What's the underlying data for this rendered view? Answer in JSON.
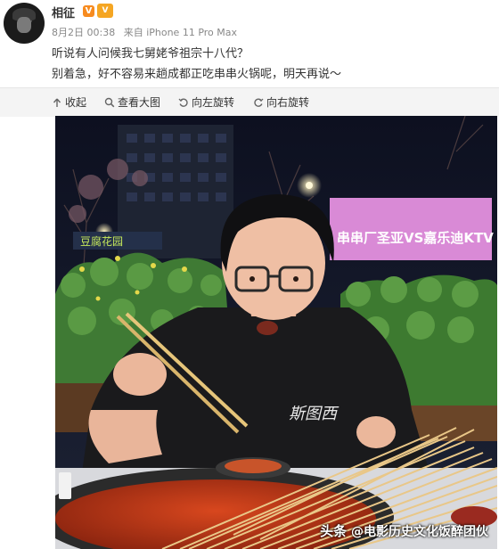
{
  "post": {
    "username": "相征",
    "v_badge": "V",
    "vip_badge": "V",
    "date": "8月2日 00:38",
    "source": "来自 iPhone 11 Pro Max",
    "text_line1": "听说有人问候我七舅姥爷祖宗十八代？",
    "text_line2": "别着急，好不容易来趟成都正吃串串火锅呢，明天再说～"
  },
  "toolbar": {
    "collapse_label": "收起",
    "view_large_label": "查看大图",
    "rotate_left_label": "向左旋转",
    "rotate_right_label": "向右旋转"
  },
  "photo": {
    "sign_left": "豆腐花园",
    "sign_right": "串串厂圣亚VS嘉乐迪KTV",
    "shirt_text": "斯图西",
    "watermark_prefix": "头条",
    "watermark_text": "@电影历史文化饭醉团伙"
  },
  "icons": {
    "collapse": "arrow-up-icon",
    "view_large": "magnifier-icon",
    "rotate_left": "rotate-left-icon",
    "rotate_right": "rotate-right-icon"
  },
  "colors": {
    "badge_orange": "#f78b1f",
    "toolbar_bg": "#f4f4f4",
    "sign_pink": "#d98ad6"
  }
}
